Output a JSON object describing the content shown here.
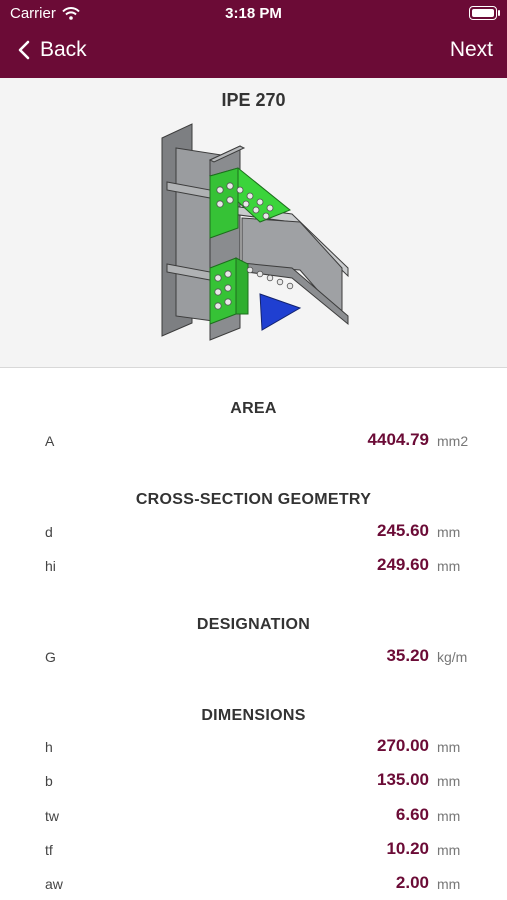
{
  "status_bar": {
    "carrier": "Carrier",
    "time": "3:18 PM"
  },
  "nav": {
    "back_label": "Back",
    "next_label": "Next"
  },
  "profile": {
    "name": "IPE 270"
  },
  "colors": {
    "brand": "#6b0b36",
    "plate": "#3bd43b",
    "stiffener": "#1f3fd1"
  },
  "sections": [
    {
      "title": "AREA",
      "rows": [
        {
          "label": "A",
          "value": "4404.79",
          "unit": "mm2"
        }
      ]
    },
    {
      "title": "CROSS-SECTION GEOMETRY",
      "rows": [
        {
          "label": "d",
          "value": "245.60",
          "unit": "mm"
        },
        {
          "label": "hi",
          "value": "249.60",
          "unit": "mm"
        }
      ]
    },
    {
      "title": "DESIGNATION",
      "rows": [
        {
          "label": "G",
          "value": "35.20",
          "unit": "kg/m"
        }
      ]
    },
    {
      "title": "DIMENSIONS",
      "rows": [
        {
          "label": "h",
          "value": "270.00",
          "unit": "mm"
        },
        {
          "label": "b",
          "value": "135.00",
          "unit": "mm"
        },
        {
          "label": "tw",
          "value": "6.60",
          "unit": "mm"
        },
        {
          "label": "tf",
          "value": "10.20",
          "unit": "mm"
        },
        {
          "label": "aw",
          "value": "2.00",
          "unit": "mm"
        }
      ]
    }
  ]
}
